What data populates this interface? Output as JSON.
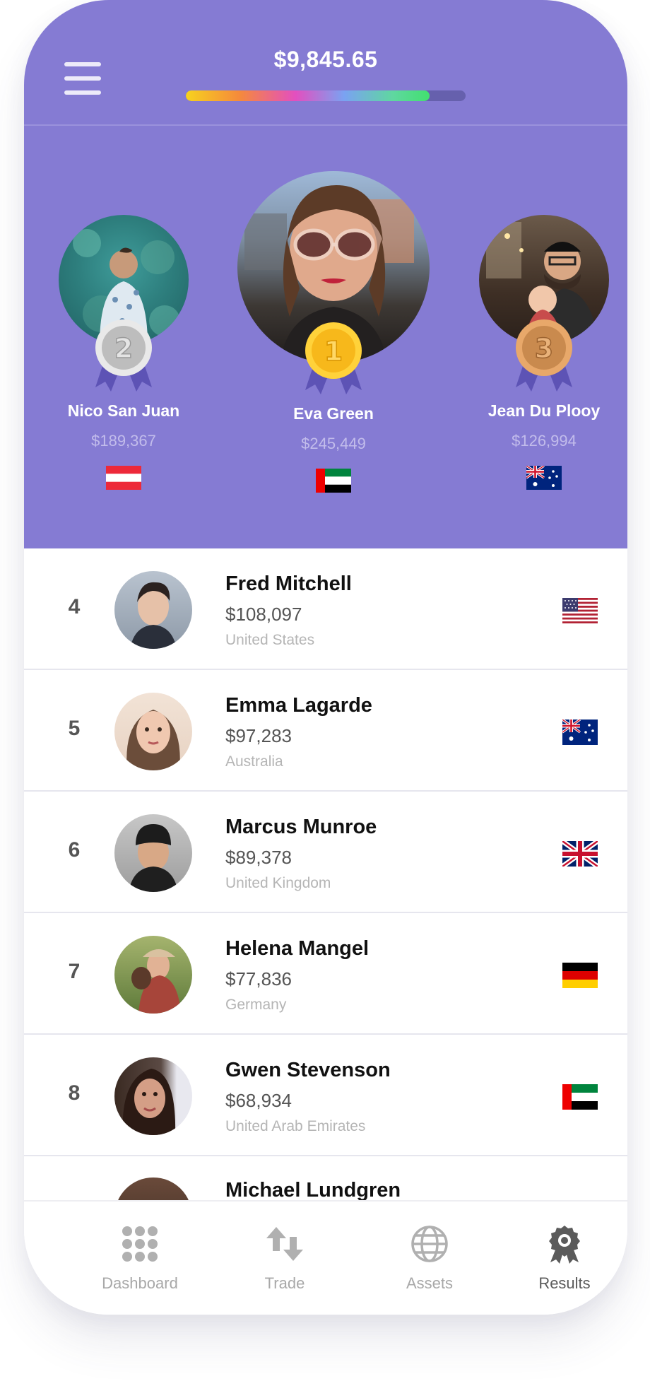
{
  "header": {
    "balance": "$9,845.65",
    "progress": 0.87,
    "menu_icon": "hamburger-menu-icon"
  },
  "podium": [
    {
      "rank": "2",
      "name": "Nico San Juan",
      "amount": "$189,367",
      "country_flag": "austria-flag-icon",
      "medal_icon": "silver-medal-icon"
    },
    {
      "rank": "1",
      "name": "Eva Green",
      "amount": "$245,449",
      "country_flag": "uae-flag-icon",
      "medal_icon": "gold-medal-icon"
    },
    {
      "rank": "3",
      "name": "Jean Du Plooy",
      "amount": "$126,994",
      "country_flag": "australia-flag-icon",
      "medal_icon": "bronze-medal-icon"
    }
  ],
  "leaderboard": [
    {
      "rank": "4",
      "name": "Fred Mitchell",
      "amount": "$108,097",
      "country": "United States",
      "flag": "usa-flag-icon"
    },
    {
      "rank": "5",
      "name": "Emma Lagarde",
      "amount": "$97,283",
      "country": "Australia",
      "flag": "australia-flag-icon"
    },
    {
      "rank": "6",
      "name": "Marcus Munroe",
      "amount": "$89,378",
      "country": "United Kingdom",
      "flag": "uk-flag-icon"
    },
    {
      "rank": "7",
      "name": "Helena Mangel",
      "amount": "$77,836",
      "country": "Germany",
      "flag": "germany-flag-icon"
    },
    {
      "rank": "8",
      "name": "Gwen Stevenson",
      "amount": "$68,934",
      "country": "United Arab Emirates",
      "flag": "uae-flag-icon"
    },
    {
      "name": "Michael Lundgren"
    }
  ],
  "tabs": [
    {
      "label": "Dashboard",
      "icon": "grid-dots-icon",
      "active": false
    },
    {
      "label": "Trade",
      "icon": "swap-arrows-icon",
      "active": false
    },
    {
      "label": "Assets",
      "icon": "globe-icon",
      "active": false
    },
    {
      "label": "Results",
      "icon": "award-badge-icon",
      "active": true
    }
  ],
  "colors": {
    "header_bg": "#857bd3",
    "gold": "#f7b81b",
    "silver": "#bdbdbd",
    "bronze": "#c98a4e",
    "ribbon": "#5d53b5"
  }
}
